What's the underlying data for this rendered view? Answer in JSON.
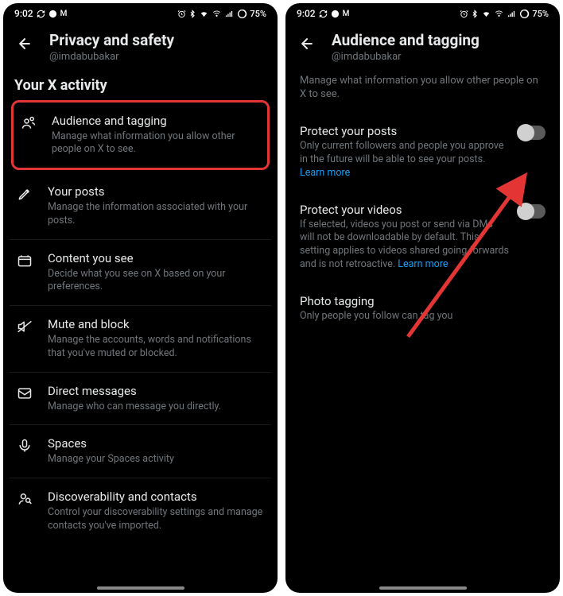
{
  "status": {
    "time": "9:02",
    "battery": "75%"
  },
  "left": {
    "header": {
      "title": "Privacy and safety",
      "handle": "@imdabubakar"
    },
    "section": "Your X activity",
    "items": [
      {
        "icon": "people",
        "title": "Audience and tagging",
        "desc": "Manage what information you allow other people on X to see."
      },
      {
        "icon": "pencil",
        "title": "Your posts",
        "desc": "Manage the information associated with your posts."
      },
      {
        "icon": "content",
        "title": "Content you see",
        "desc": "Decide what you see on X based on your preferences."
      },
      {
        "icon": "mute",
        "title": "Mute and block",
        "desc": "Manage the accounts, words and notifications that you've muted or blocked."
      },
      {
        "icon": "messages",
        "title": "Direct messages",
        "desc": "Manage who can message you directly."
      },
      {
        "icon": "mic",
        "title": "Spaces",
        "desc": "Manage your Spaces activity"
      },
      {
        "icon": "discover",
        "title": "Discoverability and contacts",
        "desc": "Control your discoverability settings and manage contacts you've imported."
      }
    ]
  },
  "right": {
    "header": {
      "title": "Audience and tagging",
      "handle": "@imdabubakar"
    },
    "intro": "Manage what information you allow other people on X to see.",
    "settings": {
      "protect_posts": {
        "title": "Protect your posts",
        "desc": "Only current followers and people you approve in the future will be able to see your posts.",
        "link": "Learn more",
        "on": false
      },
      "protect_videos": {
        "title": "Protect your videos",
        "desc": "If selected, videos you post or send via DMs will not be downloadable by default. This setting applies to videos shared going forwards and is not retroactive.",
        "link": "Learn more",
        "on": false
      },
      "photo_tagging": {
        "title": "Photo tagging",
        "desc": "Only people you follow can tag you"
      }
    }
  },
  "colors": {
    "highlight": "#e43535",
    "link": "#1d9bf0",
    "arrow": "#e43535"
  }
}
